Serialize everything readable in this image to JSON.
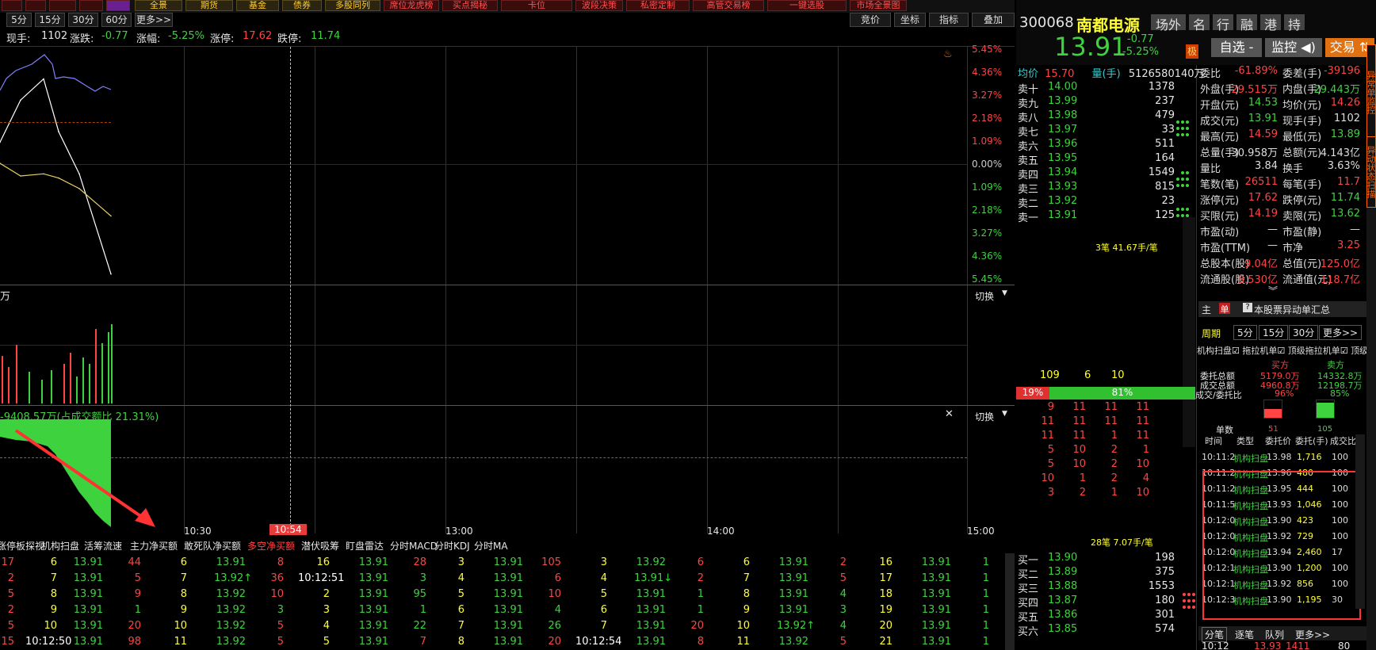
{
  "toolbar": {
    "top_buttons": [
      "全景",
      "期货",
      "基金",
      "债券",
      "多股同列",
      "席位龙虎榜",
      "买点揭秘",
      "卡位",
      "波段决策",
      "私密定制",
      "高管交易榜",
      "一键选股",
      "市场全景图"
    ],
    "period_tabs": [
      "5分",
      "15分",
      "30分",
      "60分",
      "更多>>"
    ],
    "right_menus": [
      "竞价",
      "坐标",
      "指标",
      "叠加"
    ]
  },
  "info_bar": {
    "price_label": "现手:",
    "hand": "1102",
    "change_label": "涨跌:",
    "change": "-0.77",
    "pct_label": "涨幅:",
    "pct": "-5.25%",
    "limit_up_label": "涨停:",
    "limit_up": "17.62",
    "limit_down_label": "跌停:",
    "limit_down": "11.74"
  },
  "price_axis": [
    "5.45%",
    "4.36%",
    "3.27%",
    "2.18%",
    "1.09%",
    "0.00%",
    "1.09%",
    "2.18%",
    "3.27%",
    "4.36%",
    "5.45%"
  ],
  "volume_panel": {
    "unit": "万",
    "switch_label": "切换"
  },
  "flow_panel": {
    "label": "-9408.57万(占成交额比 21.31%)",
    "switch_label": "切换"
  },
  "time_axis": {
    "t1": "10:30",
    "t2": "10:54",
    "t3": "13:00",
    "t4": "14:00",
    "t5": "15:00"
  },
  "indicator_tabs": [
    "涨停板探视",
    "机构扫盘",
    "活筹流速",
    "主力净买额",
    "敢死队净买额",
    "多空净买额",
    "潜伏吸筹",
    "盯盘雷达",
    "分时MACD",
    "分时KDJ",
    "分时MA"
  ],
  "ticks": [
    [
      [
        "17",
        "6",
        "13.91",
        "44"
      ],
      [
        "6",
        "13.91",
        "8"
      ],
      [
        "16",
        "13.91",
        "28"
      ],
      [
        "3",
        "13.91",
        "105"
      ],
      [
        "3",
        "13.92",
        "6"
      ],
      [
        "6",
        "13.91",
        "2"
      ],
      [
        "16",
        "13.91",
        "1"
      ]
    ],
    [
      [
        "2",
        "7",
        "13.91",
        "5"
      ],
      [
        "7",
        "13.92↑",
        "36"
      ],
      [
        "10:12:51",
        "13.91",
        "3"
      ],
      [
        "4",
        "13.91",
        "6"
      ],
      [
        "4",
        "13.91↓",
        "2"
      ],
      [
        "7",
        "13.91",
        "5"
      ],
      [
        "17",
        "13.91",
        "1"
      ]
    ],
    [
      [
        "5",
        "8",
        "13.91",
        "9"
      ],
      [
        "8",
        "13.92",
        "10"
      ],
      [
        "2",
        "13.91",
        "95"
      ],
      [
        "5",
        "13.91",
        "10"
      ],
      [
        "5",
        "13.91",
        "1"
      ],
      [
        "8",
        "13.91",
        "4"
      ],
      [
        "18",
        "13.91",
        "1"
      ]
    ],
    [
      [
        "2",
        "9",
        "13.91",
        "1"
      ],
      [
        "9",
        "13.92",
        "3"
      ],
      [
        "3",
        "13.91",
        "1"
      ],
      [
        "6",
        "13.91",
        "4"
      ],
      [
        "6",
        "13.91",
        "1"
      ],
      [
        "9",
        "13.91",
        "3"
      ],
      [
        "19",
        "13.91",
        "1"
      ]
    ],
    [
      [
        "5",
        "10",
        "13.91",
        "20"
      ],
      [
        "10",
        "13.92",
        "5"
      ],
      [
        "4",
        "13.91",
        "22"
      ],
      [
        "7",
        "13.91",
        "26"
      ],
      [
        "7",
        "13.91",
        "20"
      ],
      [
        "10",
        "13.92↑",
        "4"
      ],
      [
        "20",
        "13.91",
        "1"
      ]
    ],
    [
      [
        "15",
        "10:12:50",
        "13.91",
        "98"
      ],
      [
        "11",
        "13.92",
        "5"
      ],
      [
        "5",
        "13.91",
        "7"
      ],
      [
        "8",
        "13.91",
        "20"
      ],
      [
        "10:12:54",
        "13.91",
        "8"
      ],
      [
        "11",
        "13.92",
        "5"
      ],
      [
        "21",
        "13.91",
        "1"
      ]
    ]
  ],
  "stock": {
    "code": "300068",
    "name": "南都电源",
    "tags": [
      "场外",
      "名",
      "行",
      "融",
      "港",
      "持"
    ],
    "price": "13.91",
    "change": "-0.77",
    "pct": "-5.25%",
    "mark": "极",
    "btn_watch": "自选 -",
    "btn_monitor": "监控 ◀)",
    "btn_trade": "交易 ⇅"
  },
  "orderbook": {
    "avg_label": "均价",
    "avg": "15.70",
    "vol_label": "量(手)",
    "vol": "5126580140万",
    "asks": [
      [
        "卖十",
        "14.00",
        "1378"
      ],
      [
        "卖九",
        "13.99",
        "237"
      ],
      [
        "卖八",
        "13.98",
        "479"
      ],
      [
        "卖七",
        "13.97",
        "33"
      ],
      [
        "卖六",
        "13.96",
        "511"
      ],
      [
        "卖五",
        "13.95",
        "164"
      ],
      [
        "卖四",
        "13.94",
        "1549"
      ],
      [
        "卖三",
        "13.93",
        "815"
      ],
      [
        "卖二",
        "13.92",
        "23"
      ],
      [
        "卖一",
        "13.91",
        "125"
      ]
    ],
    "ask_summary": "3笔 41.67手/笔",
    "ask_counts": [
      "109",
      "6",
      "10"
    ],
    "ratio_left": "19%",
    "ratio_right": "81%",
    "queue": [
      [
        "9",
        "11",
        "11",
        "11"
      ],
      [
        "11",
        "11",
        "11",
        "11"
      ],
      [
        "11",
        "11",
        "1",
        "11"
      ],
      [
        "5",
        "10",
        "2",
        "1"
      ],
      [
        "5",
        "10",
        "2",
        "10"
      ],
      [
        "10",
        "1",
        "2",
        "4"
      ],
      [
        "3",
        "2",
        "1",
        "10"
      ]
    ],
    "bid_summary": "28笔 7.07手/笔",
    "bids": [
      [
        "买一",
        "13.90",
        "198"
      ],
      [
        "买二",
        "13.89",
        "375"
      ],
      [
        "买三",
        "13.88",
        "1553"
      ],
      [
        "买四",
        "13.87",
        "180"
      ],
      [
        "买五",
        "13.86",
        "301"
      ],
      [
        "买六",
        "13.85",
        "574"
      ]
    ]
  },
  "stats": [
    [
      [
        "委比",
        "-61.89%"
      ],
      [
        "委差(手)",
        "-39196"
      ]
    ],
    [
      [
        "外盘(手)",
        "29.515万"
      ],
      [
        "内盘(手)",
        "29.443万"
      ]
    ],
    [
      [
        "开盘(元)",
        "14.53"
      ],
      [
        "均价(元)",
        "14.26"
      ]
    ],
    [
      [
        "成交(元)",
        "13.91"
      ],
      [
        "现手(手)",
        "1102"
      ]
    ],
    [
      [
        "最高(元)",
        "14.59"
      ],
      [
        "最低(元)",
        "13.89"
      ]
    ],
    [
      [
        "总量(手)",
        "30.958万"
      ],
      [
        "总额(元)",
        "4.143亿"
      ]
    ],
    [
      [
        "量比",
        "3.84"
      ],
      [
        "换手",
        "3.63%"
      ]
    ],
    [
      [
        "笔数(笔)",
        "26511"
      ],
      [
        "每笔(手)",
        "11.7"
      ]
    ],
    [
      [
        "涨停(元)",
        "17.62"
      ],
      [
        "跌停(元)",
        "11.74"
      ]
    ],
    [
      [
        "买限(元)",
        "14.19"
      ],
      [
        "卖限(元)",
        "13.62"
      ]
    ],
    [
      [
        "市盈(动)",
        "—"
      ],
      [
        "市盈(静)",
        "—"
      ]
    ],
    [
      [
        "市盈(TTM)",
        "—"
      ],
      [
        "市净",
        "3.25"
      ]
    ],
    [
      [
        "总股本(股)",
        "9.04亿"
      ],
      [
        "总值(元)",
        "125.0亿"
      ]
    ],
    [
      [
        "流通股(股)",
        "8.530亿"
      ],
      [
        "流通值(元)",
        "118.7亿"
      ]
    ]
  ],
  "right_panel": {
    "main_tab": "主",
    "single_tab": "单",
    "summary_label": "本股票异动单汇总",
    "periods": [
      "周期",
      "5分",
      "15分",
      "30分",
      "更多>>"
    ],
    "scan_tabs": [
      "机构扫盘",
      "拖拉机单",
      "顶级拖拉机单",
      "顶级"
    ],
    "buy_label": "买方",
    "sell_label": "卖方",
    "rows": [
      [
        "委托总额",
        "5179.0万",
        "14332.8万"
      ],
      [
        "成交总额",
        "4960.8万",
        "12198.7万"
      ],
      [
        "成交/委托比",
        "96%",
        "85%"
      ]
    ],
    "single_count_label": "单数",
    "single_buy": "51",
    "single_sell": "105",
    "single_buy_pct": 0.49,
    "single_sell_pct": 0.85,
    "table_headers": [
      "时间",
      "类型",
      "委托价",
      "委托(手)",
      "成交比"
    ],
    "trades": [
      [
        "10:11:2",
        "机构扫盘",
        "13.98",
        "1,716",
        "100"
      ],
      [
        "10:11:2",
        "机构扫盘",
        "13.96",
        "480",
        "100"
      ],
      [
        "10:11:2",
        "机构扫盘",
        "13.95",
        "444",
        "100"
      ],
      [
        "10:11:5",
        "机构扫盘",
        "13.93",
        "1,046",
        "100"
      ],
      [
        "10:12:0",
        "机构扫盘",
        "13.90",
        "423",
        "100"
      ],
      [
        "10:12:0",
        "机构扫盘",
        "13.92",
        "729",
        "100"
      ],
      [
        "10:12:0",
        "机构扫盘",
        "13.94",
        "2,460",
        "17"
      ],
      [
        "10:12:1",
        "机构扫盘",
        "13.90",
        "1,200",
        "100"
      ],
      [
        "10:12:1",
        "机构扫盘",
        "13.92",
        "856",
        "100"
      ],
      [
        "10:12:3",
        "机构扫盘",
        "13.90",
        "1,195",
        "30"
      ]
    ],
    "bottom_tabs": [
      "分笔",
      "逐笔",
      "队列",
      "更多>>"
    ],
    "bottom_time": "10:12",
    "bottom_price": "13.93",
    "bottom_vol": "1411",
    "bottom_qty": "80"
  },
  "side_strip": [
    "异常单监控",
    "异动状态扫描"
  ],
  "colors": {
    "up": "#ff4444",
    "down": "#3fd23f",
    "price_line": "#8080ff",
    "avg_line": "#e6d066",
    "annotation": "#ff3333",
    "highlight_box": "#ff3333"
  },
  "chart_data": {
    "type": "line",
    "series": [
      {
        "name": "price_pct",
        "x": [
          "09:30",
          "09:40",
          "09:50",
          "10:00",
          "10:05",
          "10:12"
        ],
        "values": [
          1.0,
          3.0,
          4.0,
          1.5,
          -0.5,
          -5.25
        ]
      },
      {
        "name": "avg_pct",
        "x": [
          "09:30",
          "09:40",
          "09:50",
          "10:00",
          "10:05",
          "10:12"
        ],
        "values": [
          0.0,
          -0.6,
          -0.5,
          -0.7,
          -1.2,
          -2.5
        ]
      }
    ],
    "ylim": [
      -5.45,
      5.45
    ],
    "ylabel": "",
    "xlabel": ""
  }
}
